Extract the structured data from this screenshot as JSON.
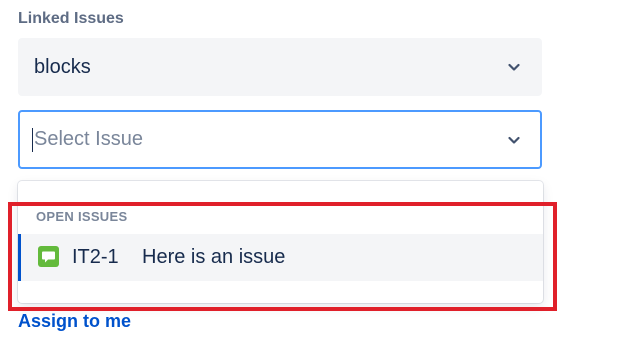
{
  "linked_issues": {
    "label": "Linked Issues",
    "relation_select": {
      "value": "blocks",
      "icon": "chevron-down-icon"
    },
    "issue_select": {
      "placeholder": "Select Issue",
      "focused": true,
      "icon": "chevron-down-icon"
    },
    "dropdown": {
      "group_heading": "OPEN ISSUES",
      "options": [
        {
          "key": "IT2-1",
          "summary": "Here is an issue",
          "issue_type_icon": "story-icon",
          "issue_type_color": "#63ba3c",
          "highlighted": true
        }
      ]
    }
  },
  "assign_link": {
    "label": "Assign to me"
  },
  "colors": {
    "focus_border": "#4c9aff",
    "option_accent": "#0052cc",
    "link": "#0052cc",
    "annotation_box": "#e0202a"
  }
}
